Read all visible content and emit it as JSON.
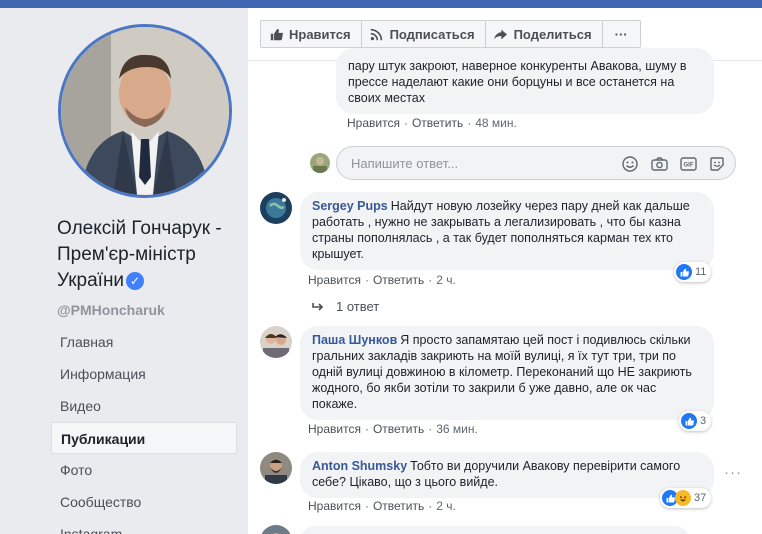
{
  "page": {
    "name": "Олексій Гончарук - Прем'єр-міністр України",
    "handle": "@PMHoncharuk"
  },
  "nav": [
    "Главная",
    "Информация",
    "Видео",
    "Публикации",
    "Фото",
    "Сообщество",
    "Instagram"
  ],
  "actions": {
    "like": "Нравится",
    "follow": "Подписаться",
    "share": "Поделиться",
    "more": "···"
  },
  "comments": [
    {
      "author": "",
      "text": "пару штук закроют, наверное конкуренты Авакова, шуму в прессе наделают какие они борцуны и все останется на своих местах",
      "like": "Нравится",
      "reply": "Ответить",
      "time": "48 мин."
    },
    {
      "author": "Sergey Pups",
      "text": "Найдут новую лозейку через пару дней как дальше работать , нужно не закрывать а легализировать , что бы казна страны пополнялась , а так будет пополняться карман тех кто крышует.",
      "like": "Нравится",
      "reply": "Ответить",
      "time": "2 ч.",
      "reactions": "11"
    },
    {
      "author": "Паша Шунков",
      "text": "Я просто запамятаю цей пост і подивлюсь скільки гральних закладів закриють на моїй вулиці, я їх тут три, три по одній вулиці довжиною в кілометр. Переконаний що НЕ закриють жодного, бо якби зотіли то закрили б уже давно, але ок час покаже.",
      "like": "Нравится",
      "reply": "Ответить",
      "time": "36 мин.",
      "reactions": "3"
    },
    {
      "author": "Anton Shumsky",
      "text": "Тобто ви доручили Авакову перевірити самого себе? Цікаво, що з цього вийде.",
      "like": "Нравится",
      "reply": "Ответить",
      "time": "2 ч.",
      "reactions": "37"
    }
  ],
  "reply_input": {
    "placeholder": "Напишите ответ..."
  },
  "replies_link": "1 ответ",
  "colors": {
    "brand": "#4267b2",
    "link": "#385898",
    "like": "#2078f4",
    "haha": "#f7b928"
  }
}
